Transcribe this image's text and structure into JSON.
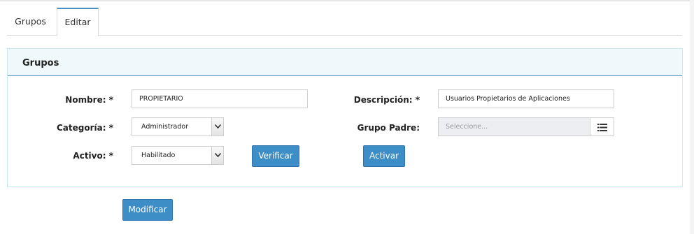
{
  "tabs": [
    {
      "label": "Grupos"
    },
    {
      "label": "Editar"
    }
  ],
  "panel": {
    "title": "Grupos"
  },
  "form": {
    "nombre": {
      "label": "Nombre: *",
      "value": "PROPIETARIO"
    },
    "descripcion": {
      "label": "Descripción: *",
      "value": "Usuarios Propietarios de Aplicaciones"
    },
    "categoria": {
      "label": "Categoría: *",
      "value": "Administrador"
    },
    "grupo_padre": {
      "label": "Grupo Padre:",
      "placeholder": "Seleccione..."
    },
    "activo": {
      "label": "Activo: *",
      "value": "Habilitado"
    }
  },
  "buttons": {
    "verificar": "Verificar",
    "activar": "Activar",
    "modificar": "Modificar"
  },
  "colors": {
    "accent": "#3d8dc7",
    "panel_header_bg": "#eff9fb",
    "panel_border": "#c7ebf0"
  },
  "icons": {
    "select_arrow": "chevron-down-icon",
    "list": "list-icon"
  }
}
